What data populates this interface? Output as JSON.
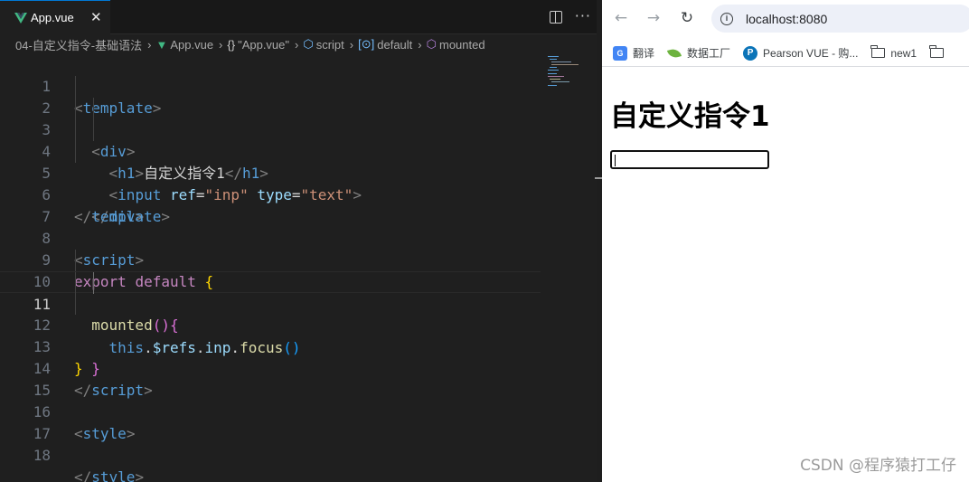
{
  "editor": {
    "tab_label": "App.vue",
    "breadcrumb": {
      "folder": "04-自定义指令-基础语法",
      "file": "App.vue",
      "component": "\"App.vue\"",
      "script": "script",
      "default": "default",
      "mounted": "mounted"
    },
    "line_numbers": [
      "1",
      "2",
      "3",
      "4",
      "5",
      "6",
      "7",
      "8",
      "9",
      "10",
      "11",
      "12",
      "13",
      "14",
      "15",
      "16",
      "17",
      "18"
    ],
    "current_line": "11",
    "code": {
      "template_tag": "template",
      "div_tag": "div",
      "h1_tag": "h1",
      "h1_text": "自定义指令1",
      "input_tag": "input",
      "ref_attr": "ref",
      "ref_value": "\"inp\"",
      "type_attr": "type",
      "type_value": "\"text\"",
      "script_tag": "script",
      "export_kw": "export",
      "default_kw": "default",
      "mounted_fn": "mounted",
      "this_kw": "this",
      "refs_prop": "$refs",
      "inp_prop": "inp",
      "focus_fn": "focus",
      "style_tag": "style"
    }
  },
  "browser": {
    "url": "localhost:8080",
    "bookmarks": [
      {
        "label": "翻译",
        "icon": "translate-icon"
      },
      {
        "label": "数据工厂",
        "icon": "leaf-icon"
      },
      {
        "label": "Pearson VUE - 购...",
        "icon": "pearson-icon"
      },
      {
        "label": "new1",
        "icon": "folder-icon"
      },
      {
        "label": "",
        "icon": "folder-icon"
      }
    ],
    "page": {
      "heading": "自定义指令1",
      "input_value": ""
    },
    "watermark": "CSDN @程序猿打工仔"
  },
  "colors": {
    "editor_bg": "#1f1f1f",
    "tag": "#569cd6",
    "attr": "#9cdcfe",
    "string": "#ce9178",
    "keyword": "#c586c0",
    "function": "#dcdcaa",
    "accent": "#0078d4",
    "vue_green": "#41b883"
  }
}
